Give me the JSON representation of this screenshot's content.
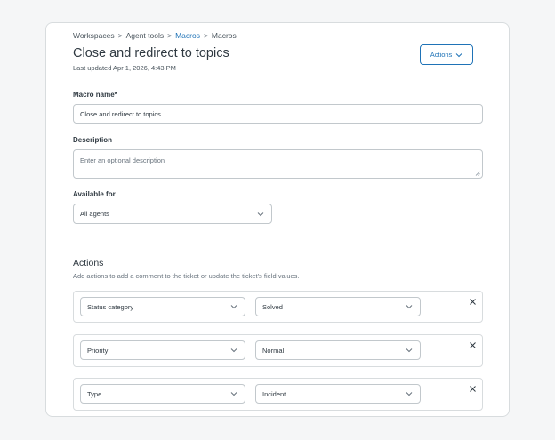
{
  "breadcrumb": [
    {
      "label": "Workspaces"
    },
    {
      "label": "Agent tools"
    },
    {
      "label": "Macros"
    },
    {
      "label": "Macros"
    }
  ],
  "breadcrumb_separator": ">",
  "page": {
    "title": "Close and redirect to topics",
    "last_updated": "Last updated Apr 1, 2026, 4:43 PM"
  },
  "header_actions": {
    "label": "Actions",
    "icon": "chevron-down-icon"
  },
  "form": {
    "macro_name": {
      "label": "Macro name*",
      "value": "Close and redirect to topics"
    },
    "description": {
      "label": "Description",
      "placeholder": "Enter an optional description"
    },
    "available_for": {
      "label": "Available for",
      "value": "All agents"
    }
  },
  "actions_section": {
    "title": "Actions",
    "description": "Add actions to add a comment to the ticket or update the ticket's field values.",
    "rows": [
      {
        "field": "Status category",
        "value": "Solved"
      },
      {
        "field": "Priority",
        "value": "Normal"
      },
      {
        "field": "Type",
        "value": "Incident"
      }
    ]
  },
  "colors": {
    "accent": "#1f73b7",
    "text": "#2f3941",
    "muted": "#68737d",
    "border": "#c2c8cc",
    "background": "#f5f6f7"
  }
}
